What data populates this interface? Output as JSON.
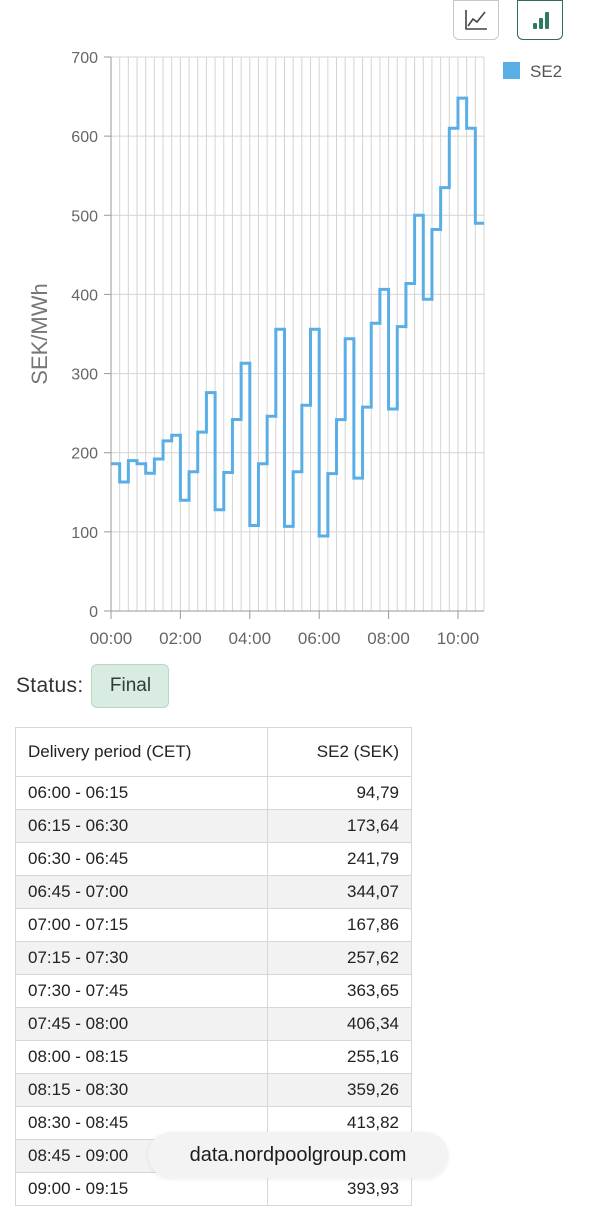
{
  "view_toggle": {
    "line_icon": "line-chart-icon",
    "bar_icon": "bar-chart-icon"
  },
  "chart_data": {
    "type": "line",
    "step": true,
    "ylabel": "SEK/MWh",
    "xlabel": "",
    "ylim": [
      0,
      700
    ],
    "yticks": [
      "0",
      "100",
      "200",
      "300",
      "400",
      "500",
      "600",
      "700"
    ],
    "xticks": [
      "00:00",
      "02:00",
      "04:00",
      "06:00",
      "08:00",
      "10:00"
    ],
    "grid": true,
    "legend": "top-right",
    "series": [
      {
        "name": "SE2",
        "color": "#5aaee6",
        "interval_minutes": 15,
        "start": "00:00",
        "values": [
          186,
          163,
          190,
          186,
          174,
          192,
          215,
          222,
          140,
          176,
          226,
          276,
          128,
          175,
          242,
          313,
          108,
          186,
          246,
          356,
          107,
          176,
          260,
          356,
          94.79,
          173.64,
          241.79,
          344.07,
          167.86,
          257.62,
          363.65,
          406.34,
          255.16,
          359.26,
          413.82,
          500,
          393.93,
          482,
          535,
          610,
          648,
          610,
          490
        ]
      }
    ]
  },
  "status": {
    "label": "Status:",
    "value": "Final"
  },
  "table": {
    "headers": [
      "Delivery period (CET)",
      "SE2 (SEK)"
    ],
    "rows": [
      [
        "06:00 - 06:15",
        "94,79"
      ],
      [
        "06:15 - 06:30",
        "173,64"
      ],
      [
        "06:30 - 06:45",
        "241,79"
      ],
      [
        "06:45 - 07:00",
        "344,07"
      ],
      [
        "07:00 - 07:15",
        "167,86"
      ],
      [
        "07:15 - 07:30",
        "257,62"
      ],
      [
        "07:30 - 07:45",
        "363,65"
      ],
      [
        "07:45 - 08:00",
        "406,34"
      ],
      [
        "08:00 - 08:15",
        "255,16"
      ],
      [
        "08:15 - 08:30",
        "359,26"
      ],
      [
        "08:30 - 08:45",
        "413,82"
      ],
      [
        "08:45 - 09:00",
        ""
      ],
      [
        "09:00 - 09:15",
        "393,93"
      ]
    ]
  },
  "source": "data.nordpoolgroup.com"
}
